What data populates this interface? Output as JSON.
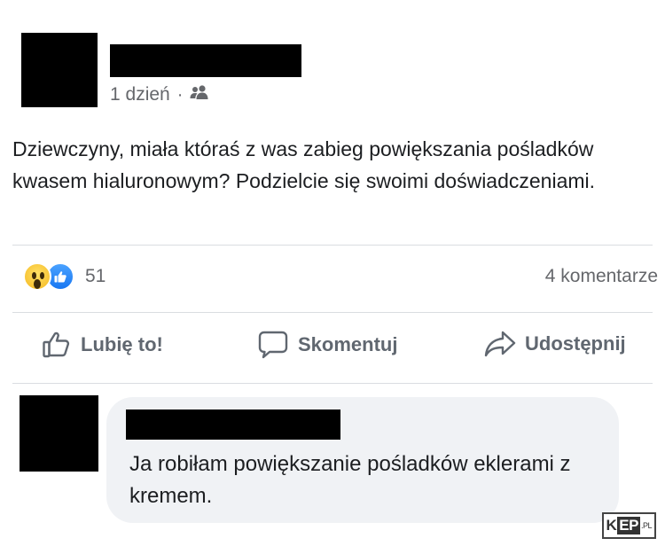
{
  "post": {
    "time": "1 dzień",
    "separator": "·",
    "audience_icon": "friends-icon",
    "text": "Dziewczyny, miała któraś z was zabieg powiększania pośladków kwasem hialuronowym? Podzielcie się swoimi doświadczeniami."
  },
  "reactions": {
    "icons": [
      "wow-icon",
      "like-icon"
    ],
    "count": "51",
    "comments": "4 komentarze"
  },
  "actions": {
    "like": "Lubię to!",
    "comment": "Skomentuj",
    "share": "Udostępnij"
  },
  "comment": {
    "text": "Ja robiłam powiększanie pośladków eklerami z kremem."
  },
  "watermark": {
    "k": "K",
    "ep": "EP",
    "pl": ".PL"
  },
  "colors": {
    "text": "#1c1e21",
    "muted": "#65676b",
    "bubble": "#f0f2f5",
    "like_blue": "#1877f2"
  }
}
